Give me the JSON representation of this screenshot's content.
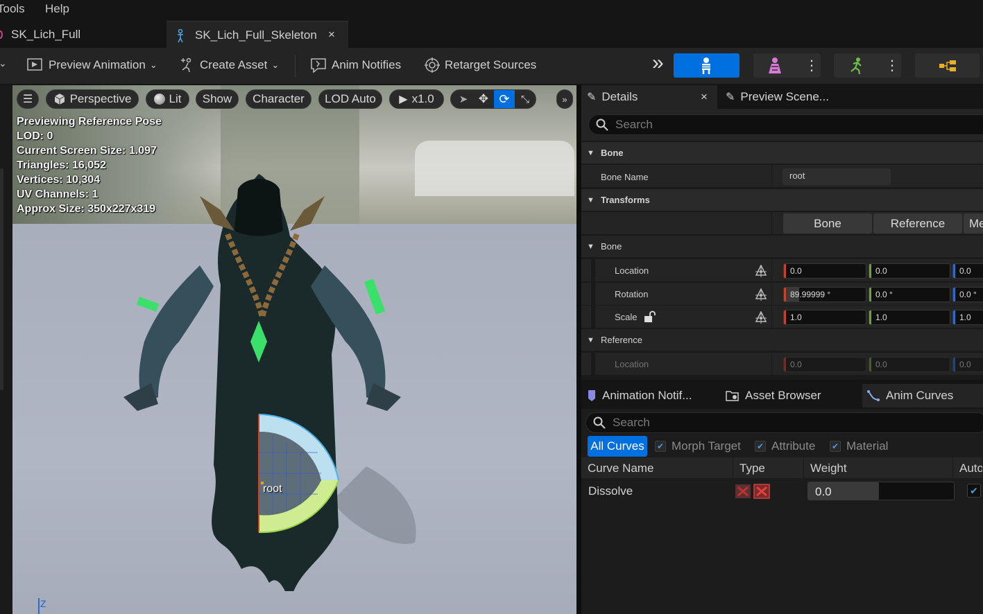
{
  "menu": {
    "items": [
      "Tools",
      "Help"
    ]
  },
  "tabs": [
    {
      "label": "SK_Lich_Full"
    },
    {
      "label": "SK_Lich_Full_Skeleton",
      "close": "×"
    }
  ],
  "toolbar": {
    "preview_animation": "Preview Animation",
    "create_asset": "Create Asset",
    "anim_notifies": "Anim Notifies",
    "retarget_sources": "Retarget Sources",
    "overflow": "»",
    "accent": "#0070e0"
  },
  "viewport": {
    "perspective": "Perspective",
    "lit": "Lit",
    "show": "Show",
    "character": "Character",
    "lod": "LOD Auto",
    "speed": "x1.0",
    "stats": [
      "Previewing Reference Pose",
      "LOD: 0",
      "Current Screen Size: 1.097",
      "Triangles: 16,052",
      "Vertices: 10,304",
      "UV Channels: 1",
      "Approx Size: 350x227x319"
    ],
    "bone_label": "root",
    "axis_label": "Z"
  },
  "details": {
    "tab": "Details",
    "close": "×",
    "preview_tab": "Preview Scene...",
    "search_placeholder": "Search",
    "bone_category": "Bone",
    "bone_name_label": "Bone Name",
    "bone_name_value": "root",
    "transforms_category": "Transforms",
    "seg_bone": "Bone",
    "seg_reference": "Reference",
    "seg_mesh": "Me",
    "bone_sub": "Bone",
    "location_label": "Location",
    "location": [
      "0.0",
      "0.0",
      "0.0"
    ],
    "rotation_label": "Rotation",
    "rotation": [
      "89.99999 °",
      "0.0 °",
      "0.0 °"
    ],
    "scale_label": "Scale",
    "scale": [
      "1.0",
      "1.0",
      "1.0"
    ],
    "reference_sub": "Reference",
    "ref_location_label": "Location",
    "ref_location": [
      "0.0",
      "0.0",
      "0.0"
    ]
  },
  "curves": {
    "tab_notifies": "Animation Notif...",
    "tab_browser": "Asset Browser",
    "tab_curves": "Anim Curves",
    "search_placeholder": "Search",
    "filter_all": "All Curves",
    "filter_morph": "Morph Target",
    "filter_attribute": "Attribute",
    "filter_material": "Material",
    "col_name": "Curve Name",
    "col_type": "Type",
    "col_weight": "Weight",
    "col_auto": "Auto",
    "row_name": "Dissolve",
    "row_weight": "0.0"
  }
}
